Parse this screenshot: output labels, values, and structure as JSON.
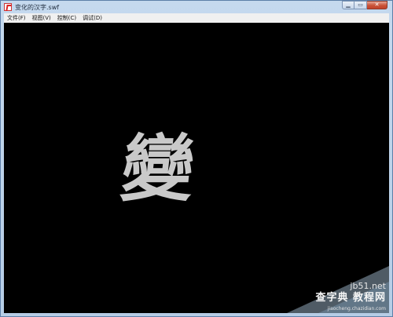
{
  "window": {
    "title": "变化的汉字.swf",
    "controls": {
      "minimize_symbol": "▁",
      "maximize_symbol": "▭",
      "close_symbol": "✕"
    }
  },
  "menu": {
    "items": [
      {
        "label": "文件(F)"
      },
      {
        "label": "视图(V)"
      },
      {
        "label": "控制(C)"
      },
      {
        "label": "调试(D)"
      }
    ]
  },
  "stage": {
    "glyph": "變",
    "glyph_color": "#c9c9c9",
    "background_color": "#000000"
  },
  "watermark": {
    "domain": "jb51.net",
    "title": "查字典 教程网",
    "subtitle": "jiaocheng.chazidian.com"
  },
  "colors": {
    "title_bar": "#c5d9ee",
    "close_button": "#c95338",
    "menu_bar": "#f0f0f0"
  }
}
